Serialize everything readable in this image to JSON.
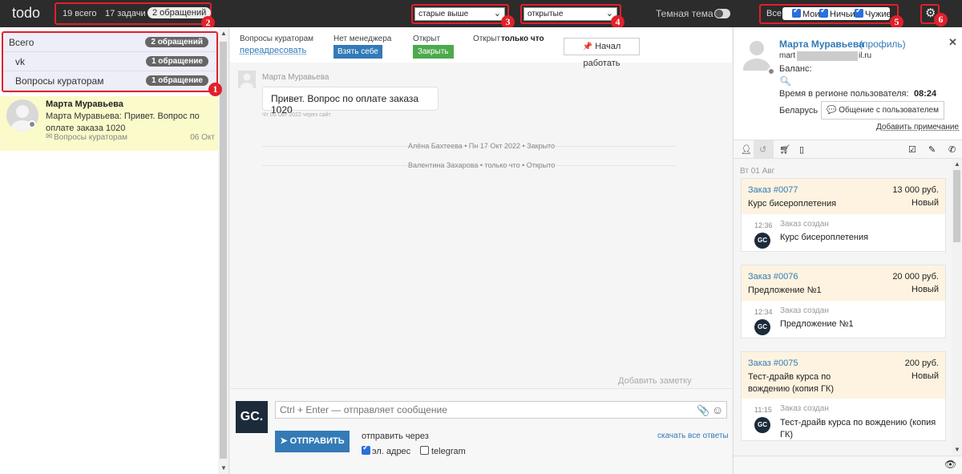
{
  "app": {
    "logo": "todo"
  },
  "topbar": {
    "stat_total": "19 всего",
    "stat_tasks": "17 задачи",
    "stat_requests": "2 обращений",
    "sort_select": "старые выше",
    "status_select": "открытые",
    "dark_theme_label": "Темная тема",
    "filter_all": "Все",
    "filter_mine": "Мои",
    "filter_nobody": "Ничьи",
    "filter_others": "Чужие"
  },
  "annotations": [
    "1",
    "2",
    "3",
    "4",
    "5",
    "6"
  ],
  "colors": {
    "annotation_red": "#e0202a",
    "primary_blue": "#337ab7",
    "green": "#4caa4c",
    "highlight_yellow": "#fafaca"
  },
  "left": {
    "categories": [
      {
        "label": "Всего",
        "count": "2 обращений"
      },
      {
        "label": "vk",
        "count": "1 обращение"
      },
      {
        "label": "Вопросы кураторам",
        "count": "1 обращение"
      }
    ],
    "conversation": {
      "name": "Марта Муравьева",
      "preview": "Марта Муравьева: Привет. Вопрос по оплате заказа 1020",
      "channel": "Вопросы кураторам",
      "date": "06 Окт"
    }
  },
  "middle": {
    "header": {
      "queue_label": "Вопросы кураторам",
      "reassign_link": "переадресовать",
      "no_manager_label": "Нет менеджера",
      "take_button": "Взять себе",
      "open_label": "Открыт",
      "close_button": "Закрыть",
      "opened_prefix": "Открыт",
      "opened_time": "только что",
      "start_button": "Начал работать"
    },
    "message": {
      "author": "Марта Муравьева",
      "text": "Привет. Вопрос по оплате заказа 1020",
      "meta": "Чт 06 Окт 2022 через сайт"
    },
    "system_events": [
      "Алёна Бахтеева • Пн 17 Окт 2022 • Закрыто",
      "Валентина Захарова • только что • Открыто"
    ],
    "add_note": "Добавить заметку",
    "compose": {
      "logo_text": "GC.",
      "placeholder": "Ctrl + Enter — отправляет сообщение",
      "send_button": "ОТПРАВИТЬ",
      "send_via_label": "отправить через",
      "channel_email": "эл. адрес",
      "channel_telegram": "telegram",
      "download_link": "скачать все ответы"
    }
  },
  "right": {
    "user_name": "Марта Муравьева",
    "profile_link": "(профиль)",
    "email_prefix": "mart",
    "email_suffix": "il.ru",
    "balance_label": "Баланс:",
    "region_time_label": "Время в регионе пользователя:",
    "region_time": "08:24",
    "country": "Беларусь",
    "chat_button": "Общение с пользователем",
    "add_note_link": "Добавить примечание",
    "date_header": "Вт 01 Авг",
    "orders": [
      {
        "num": "Заказ #0077",
        "price": "13 000 руб.",
        "title": "Курс бисероплетения",
        "status": "Новый",
        "time": "12:36",
        "event": "Заказ создан",
        "event_text": "Курс бисероплетения"
      },
      {
        "num": "Заказ #0076",
        "price": "20 000 руб.",
        "title": "Предложение №1",
        "status": "Новый",
        "time": "12:34",
        "event": "Заказ создан",
        "event_text": "Предложение №1"
      },
      {
        "num": "Заказ #0075",
        "price": "200 руб.",
        "title": "Тест-драйв курса по вождению (копия ГК)",
        "status": "Новый",
        "time": "11:15",
        "event": "Заказ создан",
        "event_text": "Тест-драйв курса по вождению (копия ГК)"
      }
    ],
    "gc_small": "GC"
  }
}
